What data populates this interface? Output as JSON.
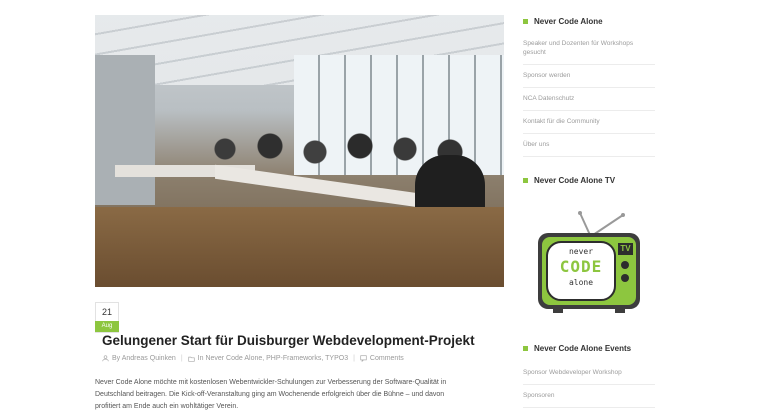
{
  "post": {
    "date_day": "21",
    "date_month": "Aug",
    "title": "Gelungener Start für Duisburger Webdevelopment-Projekt",
    "author": "By Andreas Quinken",
    "categories": "In Never Code Alone, PHP-Frameworks, TYPO3",
    "comments": "Comments",
    "excerpt_line1": "Never Code Alone möchte mit kostenlosen Webentwickler-Schulungen zur Verbesserung der Software-Qualität in",
    "excerpt_line2": "Deutschland beitragen. Die Kick-off-Veranstaltung ging am Wochenende erfolgreich über die Bühne – und davon",
    "excerpt_line3": "profitiert am Ende auch ein wohltätiger Verein."
  },
  "sidebar": {
    "section1_title": "Never Code Alone",
    "links": [
      "Speaker und Dozenten für Workshops gesucht",
      "Sponsor werden",
      "NCA Datenschutz",
      "Kontakt für die Community",
      "Über uns"
    ],
    "section2_title": "Never Code Alone TV",
    "tv_logo_line1": "never",
    "tv_logo_line2": "CODE",
    "tv_logo_line3": "alone",
    "tv_badge": "TV",
    "section3_title": "Never Code Alone Events",
    "events": [
      "Sponsor Webdeveloper Workshop",
      "Sponsoren"
    ]
  },
  "colors": {
    "accent": "#8dc63f",
    "text": "#222222",
    "muted": "#9c9c9c"
  }
}
